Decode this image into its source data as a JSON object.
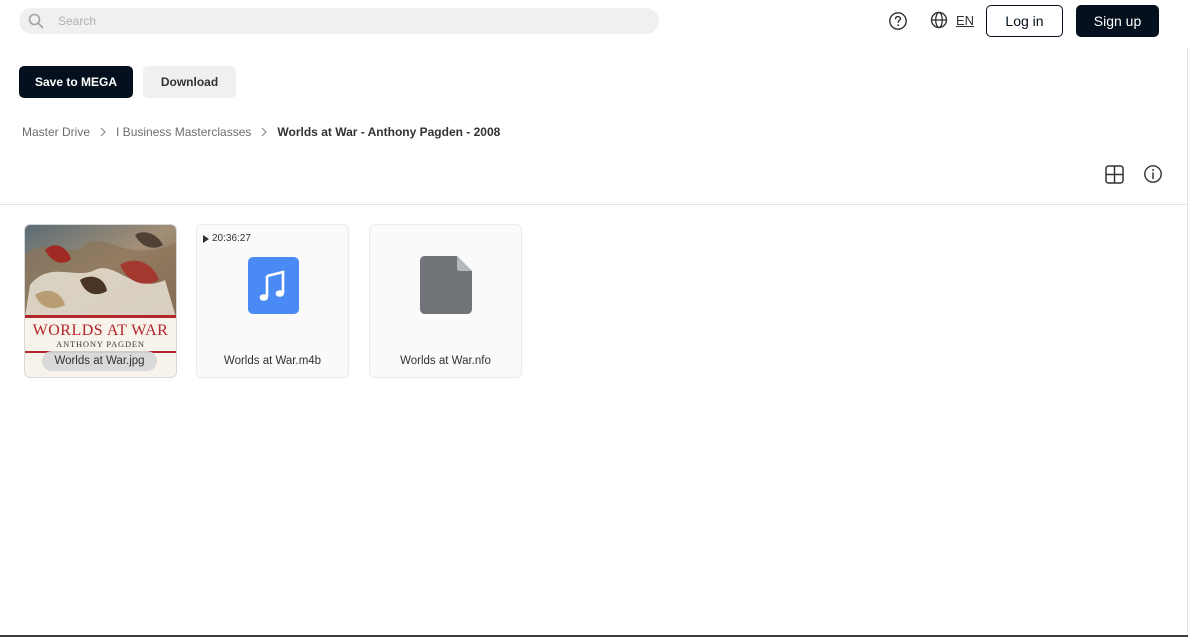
{
  "header": {
    "search_placeholder": "Search",
    "help_icon": "help-circle-icon",
    "language_icon": "globe-icon",
    "language_label": "EN",
    "login_label": "Log in",
    "signup_label": "Sign up"
  },
  "actions": {
    "save_label": "Save to MEGA",
    "download_label": "Download"
  },
  "breadcrumb": [
    {
      "label": "Master Drive"
    },
    {
      "label": "I Business Masterclasses"
    },
    {
      "label": "Worlds at War - Anthony Pagden - 2008"
    }
  ],
  "toolbar": {
    "view_icon": "grid-view-icon",
    "info_icon": "info-icon"
  },
  "files": [
    {
      "name": "Worlds at War.jpg",
      "type": "image",
      "cover_title": "WORLDS AT WAR",
      "cover_author": "ANTHONY PAGDEN"
    },
    {
      "name": "Worlds at War.m4b",
      "type": "audio",
      "duration": "20:36:27"
    },
    {
      "name": "Worlds at War.nfo",
      "type": "document"
    }
  ],
  "colors": {
    "primary": "#04101e",
    "secondary_bg": "#f0f0f0",
    "audio_icon": "#4a8af4",
    "doc_icon": "#707479",
    "cover_red": "#b2262d"
  }
}
